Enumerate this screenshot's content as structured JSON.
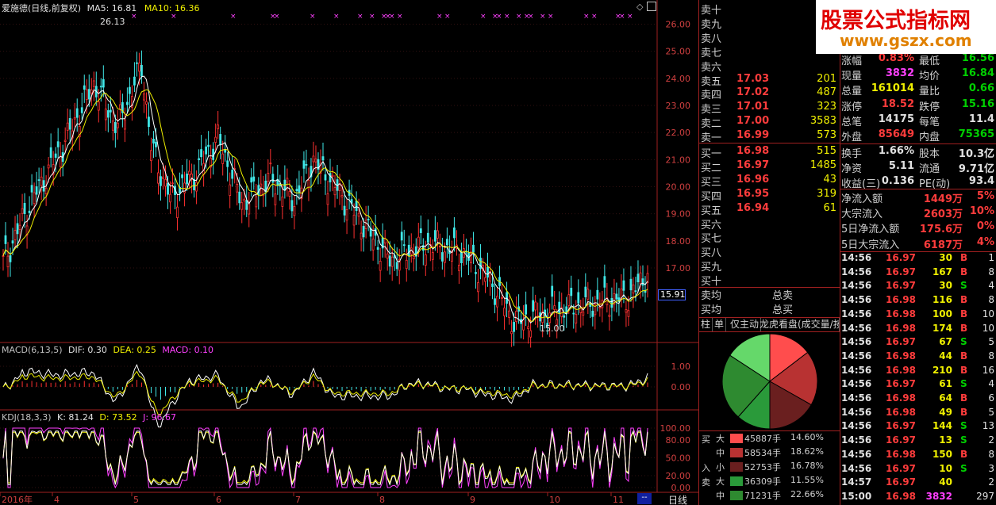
{
  "stock": {
    "name": "爱施德(日线,前复权)",
    "ma5": "MA5: 16.81",
    "ma10": "MA10: 16.36"
  },
  "kline": {
    "ylim": [
      14.6,
      26.6
    ],
    "price_ticks": [
      "26.00",
      "25.00",
      "24.00",
      "23.00",
      "22.00",
      "21.00",
      "20.00",
      "19.00",
      "18.00",
      "17.00"
    ],
    "current_price_tag": "15.91",
    "high_label": "26.13",
    "low_label": "15.00",
    "x_labels": [
      "2016年",
      "4",
      "5",
      "6",
      "7",
      "8",
      "9",
      "10",
      "11"
    ],
    "period_tab": "日线"
  },
  "macd": {
    "title": "MACD(6,13,5)",
    "dif": "DIF: 0.30",
    "dea": "DEA: 0.25",
    "macd": "MACD: 0.10",
    "ticks": [
      "1.00",
      "0.00"
    ]
  },
  "kdj": {
    "title": "KDJ(18,3,3)",
    "k": "K: 81.24",
    "d": "D: 73.52",
    "j": "J: 96.67",
    "ticks": [
      "100.00",
      "80.00",
      "50.00",
      "20.00",
      "0.00"
    ]
  },
  "orderbook": {
    "sell": [
      {
        "label": "卖十",
        "price": "",
        "vol": ""
      },
      {
        "label": "卖九",
        "price": "",
        "vol": ""
      },
      {
        "label": "卖八",
        "price": "",
        "vol": ""
      },
      {
        "label": "卖七",
        "price": "",
        "vol": ""
      },
      {
        "label": "卖六",
        "price": "",
        "vol": ""
      },
      {
        "label": "卖五",
        "price": "17.03",
        "vol": "201"
      },
      {
        "label": "卖四",
        "price": "17.02",
        "vol": "487"
      },
      {
        "label": "卖三",
        "price": "17.01",
        "vol": "323"
      },
      {
        "label": "卖二",
        "price": "17.00",
        "vol": "3583"
      },
      {
        "label": "卖一",
        "price": "16.99",
        "vol": "573"
      }
    ],
    "buy": [
      {
        "label": "买一",
        "price": "16.98",
        "vol": "515"
      },
      {
        "label": "买二",
        "price": "16.97",
        "vol": "1485"
      },
      {
        "label": "买三",
        "price": "16.96",
        "vol": "43"
      },
      {
        "label": "买四",
        "price": "16.95",
        "vol": "319"
      },
      {
        "label": "买五",
        "price": "16.94",
        "vol": "61"
      },
      {
        "label": "买六",
        "price": "",
        "vol": ""
      },
      {
        "label": "买七",
        "price": "",
        "vol": ""
      },
      {
        "label": "买八",
        "price": "",
        "vol": ""
      },
      {
        "label": "买九",
        "price": "",
        "vol": ""
      },
      {
        "label": "买十",
        "price": "",
        "vol": ""
      }
    ],
    "avg_sell_label": "卖均",
    "avg_buy_label": "买均",
    "total_sell_label": "总卖",
    "total_buy_label": "总买"
  },
  "stats": [
    {
      "l1": "涨幅",
      "v1": "0.83%",
      "c1": "red",
      "l2": "最低",
      "v2": "16.56",
      "c2": "green"
    },
    {
      "l1": "现量",
      "v1": "3832",
      "c1": "magenta",
      "l2": "均价",
      "v2": "16.84",
      "c2": "green"
    },
    {
      "l1": "总量",
      "v1": "161014",
      "c1": "yellow",
      "l2": "量比",
      "v2": "0.66",
      "c2": "green"
    },
    {
      "l1": "涨停",
      "v1": "18.52",
      "c1": "red",
      "l2": "跌停",
      "v2": "15.16",
      "c2": "green"
    },
    {
      "l1": "总笔",
      "v1": "14175",
      "c1": "white",
      "l2": "每笔",
      "v2": "11.4",
      "c2": "white"
    },
    {
      "l1": "外盘",
      "v1": "85649",
      "c1": "red",
      "l2": "内盘",
      "v2": "75365",
      "c2": "green"
    },
    {
      "l1": "换手",
      "v1": "1.66%",
      "c1": "white",
      "l2": "股本",
      "v2": "10.3亿",
      "c2": "white"
    },
    {
      "l1": "净资",
      "v1": "5.11",
      "c1": "white",
      "l2": "流通",
      "v2": "9.71亿",
      "c2": "white"
    },
    {
      "l1": "收益(三)",
      "v1": "0.136",
      "c1": "white",
      "l2": "PE(动)",
      "v2": "93.4",
      "c2": "white"
    }
  ],
  "flows": [
    {
      "label": "净流入额",
      "value": "1449万",
      "pct": "5%"
    },
    {
      "label": "大宗流入",
      "value": "2603万",
      "pct": "10%"
    },
    {
      "label": "5日净流入额",
      "value": "175.6万",
      "pct": "0%"
    },
    {
      "label": "5日大宗流入",
      "value": "6187万",
      "pct": "4%"
    }
  ],
  "trades": [
    {
      "t": "14:56",
      "p": "16.97",
      "v": "30",
      "s": "B",
      "n": "1"
    },
    {
      "t": "14:56",
      "p": "16.97",
      "v": "167",
      "s": "B",
      "n": "8"
    },
    {
      "t": "14:56",
      "p": "16.97",
      "v": "30",
      "s": "S",
      "n": "4"
    },
    {
      "t": "14:56",
      "p": "16.98",
      "v": "116",
      "s": "B",
      "n": "8"
    },
    {
      "t": "14:56",
      "p": "16.98",
      "v": "100",
      "s": "B",
      "n": "10"
    },
    {
      "t": "14:56",
      "p": "16.98",
      "v": "174",
      "s": "B",
      "n": "10"
    },
    {
      "t": "14:56",
      "p": "16.97",
      "v": "67",
      "s": "S",
      "n": "5"
    },
    {
      "t": "14:56",
      "p": "16.98",
      "v": "44",
      "s": "B",
      "n": "8"
    },
    {
      "t": "14:56",
      "p": "16.98",
      "v": "210",
      "s": "B",
      "n": "16"
    },
    {
      "t": "14:56",
      "p": "16.97",
      "v": "61",
      "s": "S",
      "n": "4"
    },
    {
      "t": "14:56",
      "p": "16.98",
      "v": "64",
      "s": "B",
      "n": "6"
    },
    {
      "t": "14:56",
      "p": "16.98",
      "v": "49",
      "s": "B",
      "n": "5"
    },
    {
      "t": "14:56",
      "p": "16.97",
      "v": "144",
      "s": "S",
      "n": "13"
    },
    {
      "t": "14:56",
      "p": "16.97",
      "v": "13",
      "s": "S",
      "n": "2"
    },
    {
      "t": "14:56",
      "p": "16.98",
      "v": "150",
      "s": "B",
      "n": "8"
    },
    {
      "t": "14:56",
      "p": "16.97",
      "v": "10",
      "s": "S",
      "n": "3"
    },
    {
      "t": "14:57",
      "p": "16.97",
      "v": "40",
      "s": "",
      "n": "2"
    },
    {
      "t": "15:00",
      "p": "16.98",
      "v": "3832",
      "s": "",
      "n": "297"
    }
  ],
  "tabs": [
    "柱",
    "单",
    "仅主动",
    "龙虎看盘(成交量/按"
  ],
  "pie": {
    "slices": [
      {
        "value": 14.6,
        "color": "#ff4d4d"
      },
      {
        "value": 18.62,
        "color": "#b83232"
      },
      {
        "value": 16.78,
        "color": "#6a1f1f"
      },
      {
        "value": 11.55,
        "color": "#2a9a3a"
      },
      {
        "value": 22.66,
        "color": "#2e8a30"
      },
      {
        "value": 15.79,
        "color": "#65d86a"
      }
    ]
  },
  "moneyflow": {
    "in_label": "买",
    "in_label2": "入",
    "out_label": "卖",
    "rows": [
      {
        "size": "大",
        "vol": "45887手",
        "pct": "14.60%",
        "color": "#ff4d4d"
      },
      {
        "size": "中",
        "vol": "58534手",
        "pct": "18.62%",
        "color": "#b83232"
      },
      {
        "size": "小",
        "vol": "52753手",
        "pct": "16.78%",
        "color": "#6a1f1f"
      },
      {
        "size": "大",
        "vol": "36309手",
        "pct": "11.55%",
        "color": "#2a9a3a"
      },
      {
        "size": "中",
        "vol": "71231手",
        "pct": "22.66%",
        "color": "#2e8a30"
      }
    ]
  },
  "banner": {
    "title": "股票公式指标网",
    "url": "www.gszx.com"
  }
}
